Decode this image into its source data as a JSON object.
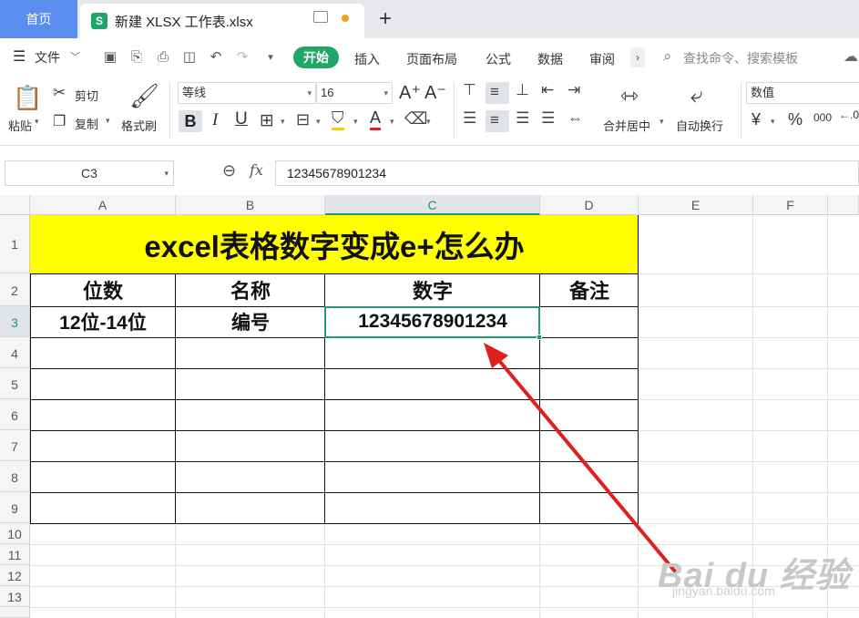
{
  "tabs": {
    "home": "首页",
    "file": "新建 XLSX 工作表.xlsx",
    "sheet_logo": "S",
    "plus": "+"
  },
  "menu": {
    "file": "文件",
    "items": [
      "开始",
      "插入",
      "页面布局",
      "公式",
      "数据",
      "审阅"
    ],
    "search_placeholder": "查找命令、搜索模板"
  },
  "ribbon": {
    "paste": "粘贴",
    "cut": "剪切",
    "copy": "复制",
    "format_painter": "格式刷",
    "font_name": "等线",
    "font_size": "16",
    "bold": "B",
    "italic": "I",
    "underline": "U",
    "font_color": "A",
    "merge_center": "合并居中",
    "wrap_text": "自动换行",
    "number_format": "数值",
    "currency": "¥",
    "percent": "%",
    "thousands": "000"
  },
  "formula_bar": {
    "cell_ref": "C3",
    "fx": "fx",
    "value": "12345678901234"
  },
  "columns": [
    "A",
    "B",
    "C",
    "D",
    "E",
    "F"
  ],
  "rows": [
    "1",
    "2",
    "3",
    "4",
    "5",
    "6",
    "7",
    "8",
    "9",
    "10",
    "11",
    "12",
    "13"
  ],
  "sheet": {
    "title": "excel表格数字变成e+怎么办",
    "headers": [
      "位数",
      "名称",
      "数字",
      "备注"
    ],
    "row3": [
      "12位-14位",
      "编号",
      "12345678901234",
      ""
    ]
  },
  "watermark": {
    "brand": "Bai du 经验",
    "url": "jingyan.baidu.com"
  },
  "colors": {
    "accent_green": "#1fa766",
    "home_tab_blue": "#5a8def",
    "title_fill": "#ffff00",
    "arrow_red": "#e02020"
  }
}
